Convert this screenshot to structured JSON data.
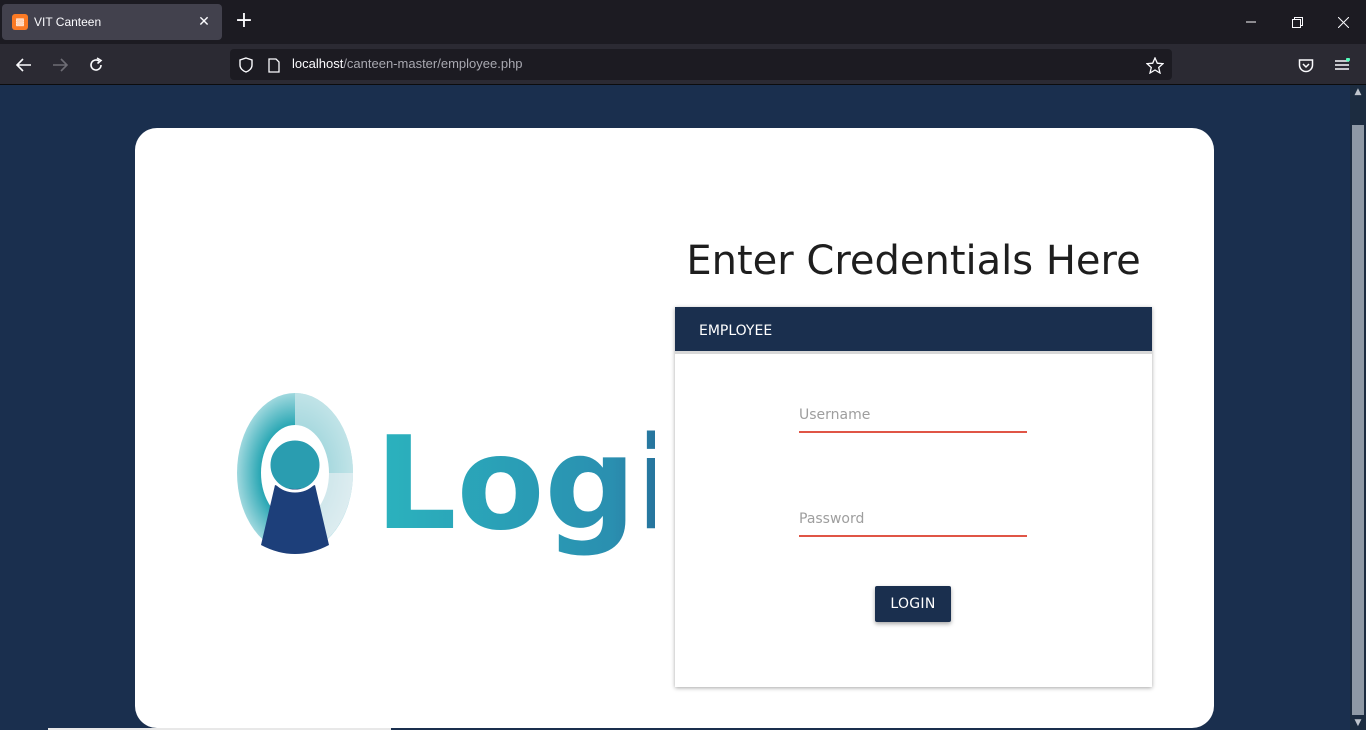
{
  "browser": {
    "tab_title": "VIT Canteen",
    "tab_favicon": "xampp-icon",
    "url_host": "localhost",
    "url_path": "/canteen-master/employee.php"
  },
  "page": {
    "heading": "Enter Credentials Here",
    "logo_text": "Login",
    "panel_tab": "EMPLOYEE",
    "username_placeholder": "Username",
    "password_placeholder": "Password",
    "login_button": "LOGIN"
  },
  "colors": {
    "background": "#1a2f4e",
    "input_underline": "#e05546",
    "logo_teal": "#2aa7b4",
    "logo_navy": "#1d2c6b"
  }
}
